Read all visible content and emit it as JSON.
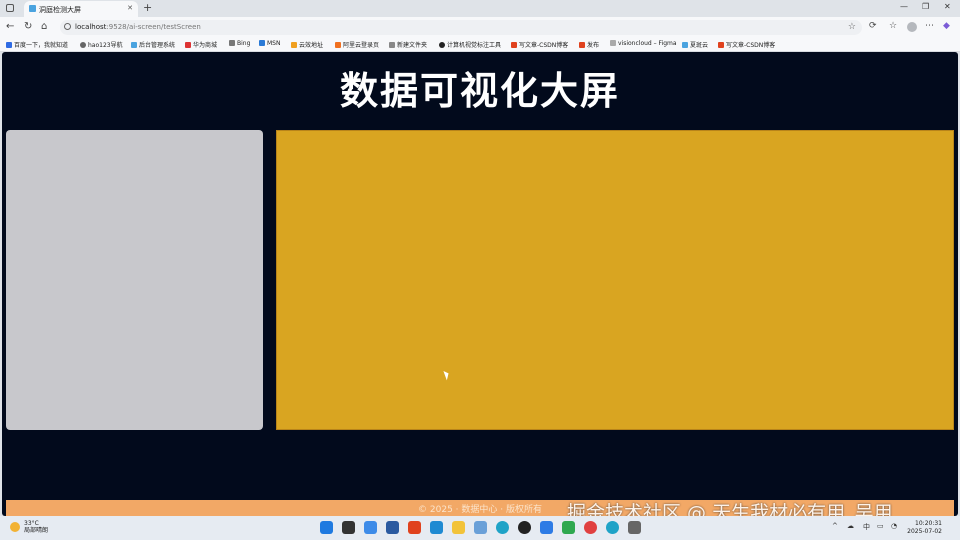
{
  "browser": {
    "tab_title": "洞庭检测大屏",
    "url_host": "localhost",
    "url_rest": ":9528/ai-screen/testScreen",
    "bookmarks": [
      "百度一下，我就知道",
      "hao123导航",
      "后台管理系统",
      "华为商城",
      "Bing",
      "MSN",
      "云效地址",
      "阿里云登录页",
      "新建文件夹",
      "计算机视觉标注工具",
      "写文章-CSDN博客",
      "发布",
      "visioncloud – Figma",
      "夏斑云",
      "写文章-CSDN博客"
    ]
  },
  "page": {
    "title": "数据可视化大屏",
    "footer_text": "© 2025 · 数据中心 · 版权所有",
    "colors": {
      "background": "#020a1c",
      "left_panel": "#c8c8cc",
      "right_panel": "#d9a521",
      "footer": "#f2a866"
    }
  },
  "watermark": "掘金技术社区 @ 天生我材必有用_吴用",
  "taskbar": {
    "weather_temp": "33°C",
    "weather_desc": "局部晴朗",
    "ime": "中",
    "time": "10:20:31",
    "date": "2025-07-02"
  }
}
